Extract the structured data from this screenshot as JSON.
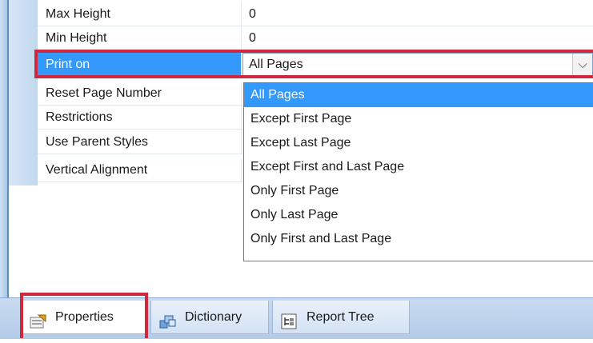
{
  "property_grid": {
    "rows": [
      {
        "name": "Max Height",
        "value": "0"
      },
      {
        "name": "Min Height",
        "value": "0"
      },
      {
        "name": "Print on",
        "value": "All Pages"
      },
      {
        "name": "Reset Page Number",
        "value": ""
      },
      {
        "name": "Restrictions",
        "value": ""
      },
      {
        "name": "Use Parent Styles",
        "value": ""
      },
      {
        "name": "Vertical Alignment",
        "value": ""
      }
    ],
    "selected_row": "Print on"
  },
  "print_on_dropdown": {
    "selected": "All Pages",
    "options": [
      "All Pages",
      "Except First Page",
      "Except Last Page",
      "Except First and Last Page",
      "Only First Page",
      "Only Last Page",
      "Only First and Last Page"
    ],
    "arrow_icon": "chevron-down-icon"
  },
  "tabs": [
    {
      "label": "Properties",
      "icon": "properties-icon",
      "active": true
    },
    {
      "label": "Dictionary",
      "icon": "dictionary-icon",
      "active": false
    },
    {
      "label": "Report Tree",
      "icon": "report-tree-icon",
      "active": false
    }
  ],
  "colors": {
    "selection": "#3399ff",
    "highlight_box": "#d0283c",
    "frame_blue": "#aac6e6"
  }
}
